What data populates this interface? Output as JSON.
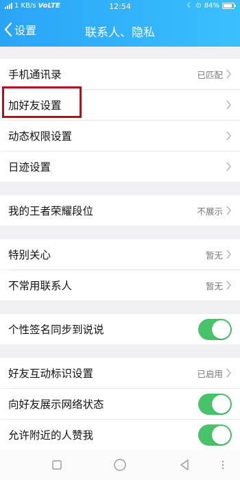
{
  "status_bar": {
    "network": "1 KB/s",
    "carrier": "VoLTE",
    "time": "12:54",
    "battery": "84%"
  },
  "nav": {
    "back_label": "设置",
    "title": "联系人、隐私"
  },
  "groups": [
    {
      "items": [
        {
          "label": "手机通讯录",
          "value": "已匹配",
          "type": "link"
        },
        {
          "label": "加好友设置",
          "value": "",
          "type": "link"
        },
        {
          "label": "动态权限设置",
          "value": "",
          "type": "link"
        },
        {
          "label": "日迹设置",
          "value": "",
          "type": "link"
        }
      ]
    },
    {
      "items": [
        {
          "label": "我的王者荣耀段位",
          "value": "不展示",
          "type": "link"
        }
      ]
    },
    {
      "items": [
        {
          "label": "特别关心",
          "value": "暂无",
          "type": "link"
        },
        {
          "label": "不常用联系人",
          "value": "暂无",
          "type": "link"
        }
      ]
    },
    {
      "items": [
        {
          "label": "个性签名同步到说说",
          "type": "toggle",
          "on": true
        }
      ]
    },
    {
      "items": [
        {
          "label": "好友互动标识设置",
          "value": "已启用",
          "type": "link"
        },
        {
          "label": "向好友展示网络状态",
          "type": "toggle",
          "on": true
        },
        {
          "label": "允许附近的人赞我",
          "type": "toggle",
          "on": true
        }
      ]
    }
  ],
  "colors": {
    "header_gradient_start": "#2aa5f5",
    "toggle_on": "#47c469",
    "highlight_box": "#b01019"
  }
}
